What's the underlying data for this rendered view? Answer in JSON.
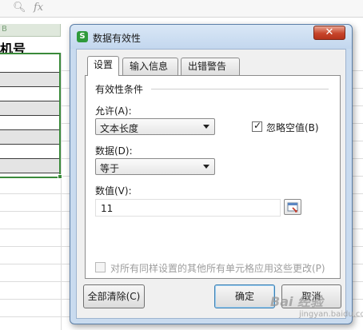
{
  "formula_bar": {
    "fx_label": "fx"
  },
  "sheet": {
    "column_letter": "B",
    "header_cell": "机号"
  },
  "dialog": {
    "app_icon_letter": "S",
    "title": "数据有效性",
    "close_label": "✕",
    "tabs": [
      {
        "label": "设置",
        "active": true
      },
      {
        "label": "输入信息",
        "active": false
      },
      {
        "label": "出错警告",
        "active": false
      }
    ],
    "settings": {
      "group_label": "有效性条件",
      "allow_label": "允许(A):",
      "allow_value": "文本长度",
      "ignore_blank_label": "忽略空值(B)",
      "ignore_blank_checked": true,
      "data_label": "数据(D):",
      "data_value": "等于",
      "value_label": "数值(V):",
      "value_input": "11",
      "apply_all_label": "对所有同样设置的其他所有单元格应用这些更改(P)",
      "apply_all_checked": false
    },
    "buttons": {
      "clear_all": "全部清除(C)",
      "ok": "确定",
      "cancel": "取消"
    }
  },
  "watermark": {
    "brand": "Bai 经验",
    "sub": "jingyan.baidu.com"
  },
  "colors": {
    "selection_border": "#3a8a3a",
    "dialog_frame": "#c9dbef",
    "close_button": "#c7452b",
    "app_icon": "#2f9a3b"
  }
}
